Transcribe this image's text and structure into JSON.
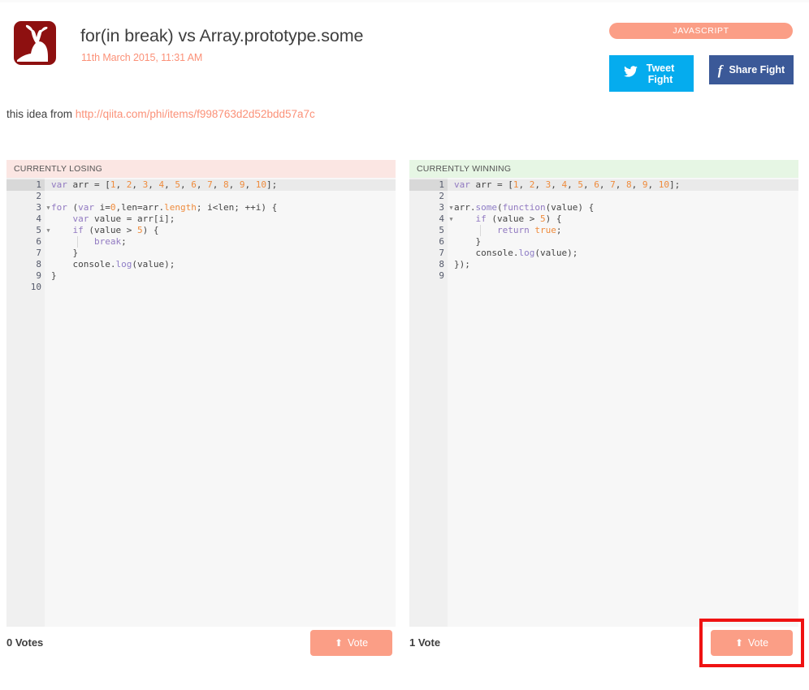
{
  "header": {
    "logo_icon": "stag-head-logo",
    "title": "for(in break) vs Array.prototype.some",
    "timestamp": "11th March 2015, 11:31 AM",
    "language_badge": "JAVASCRIPT",
    "tweet_label": "Tweet Fight",
    "tweet_icon": "twitter-bird-icon",
    "share_label": "Share Fight",
    "share_icon": "facebook-f-icon"
  },
  "idea": {
    "prefix": "this idea from ",
    "url": "http://qiita.com/phi/items/f998763d2d52bdd57a7c"
  },
  "panels": {
    "left": {
      "status": "CURRENTLY LOSING",
      "votes_label": "0 Votes",
      "vote_button": "Vote",
      "vote_icon": "arrow-up-icon",
      "active_line": 1,
      "fold_lines": [
        3,
        5
      ],
      "line_count": 10,
      "lines": [
        "var arr = [1, 2, 3, 4, 5, 6, 7, 8, 9, 10];",
        "",
        "for (var i=0,len=arr.length; i<len; ++i) {",
        "    var value = arr[i];",
        "    if (value > 5) {",
        "        break;",
        "    }",
        "    console.log(value);",
        "}",
        ""
      ]
    },
    "right": {
      "status": "CURRENTLY WINNING",
      "votes_label": "1 Vote",
      "vote_button": "Vote",
      "vote_icon": "arrow-up-icon",
      "active_line": 1,
      "fold_lines": [
        3,
        4
      ],
      "line_count": 9,
      "lines": [
        "var arr = [1, 2, 3, 4, 5, 6, 7, 8, 9, 10];",
        "",
        "arr.some(function(value) {",
        "    if (value > 5) {",
        "        return true;",
        "    }",
        "    console.log(value);",
        "});",
        ""
      ]
    }
  },
  "colors": {
    "accent": "#fb9e86",
    "logo": "#8e1010",
    "twitter": "#05acee",
    "facebook": "#3b5998",
    "losing_header": "#fbe6e3",
    "winning_header": "#e6f6e4",
    "highlight": "#ef1212"
  }
}
